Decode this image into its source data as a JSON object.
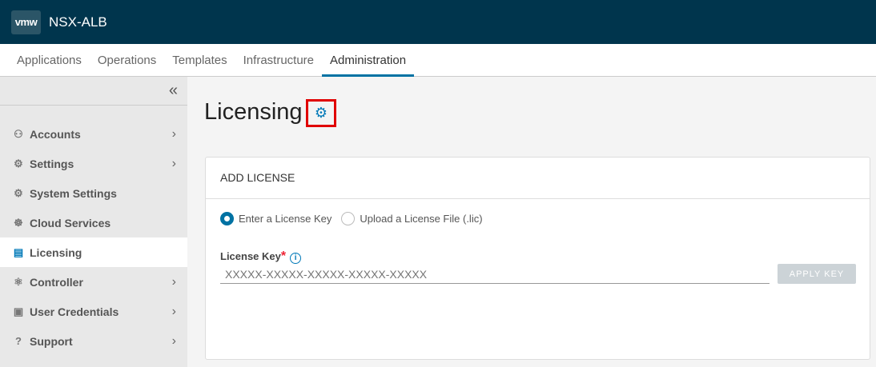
{
  "header": {
    "logo": "vmw",
    "app_name": "NSX-ALB"
  },
  "tabs": [
    {
      "label": "Applications"
    },
    {
      "label": "Operations"
    },
    {
      "label": "Templates"
    },
    {
      "label": "Infrastructure"
    },
    {
      "label": "Administration"
    }
  ],
  "sidebar": {
    "collapse": "«",
    "items": [
      {
        "label": "Accounts",
        "icon": "⚇",
        "chev": "›"
      },
      {
        "label": "Settings",
        "icon": "⚙",
        "chev": "›"
      },
      {
        "label": "System Settings",
        "icon": "⚙"
      },
      {
        "label": "Cloud Services",
        "icon": "☸"
      },
      {
        "label": "Licensing",
        "icon": "▤"
      },
      {
        "label": "Controller",
        "icon": "⚛",
        "chev": "›"
      },
      {
        "label": "User Credentials",
        "icon": "▣",
        "chev": "›"
      },
      {
        "label": "Support",
        "icon": "?",
        "chev": "›"
      }
    ]
  },
  "page": {
    "title": "Licensing",
    "gear": "⚙"
  },
  "card": {
    "header": "ADD LICENSE",
    "radio1": "Enter a License Key",
    "radio2": "Upload a License File (.lic)",
    "key_label": "License Key",
    "required": "*",
    "info": "i",
    "placeholder": "XXXXX-XXXXX-XXXXX-XXXXX-XXXXX",
    "apply": "APPLY KEY"
  }
}
